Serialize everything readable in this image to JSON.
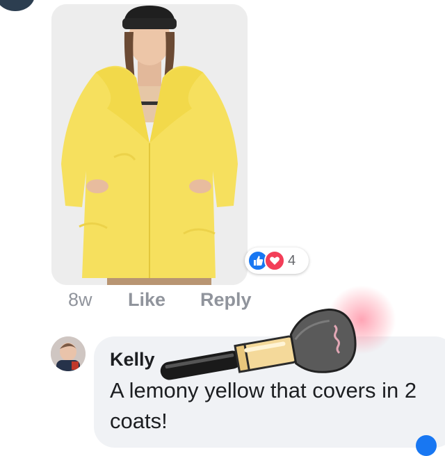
{
  "post": {
    "photo_alt": "yellow-fur-coat-photo",
    "reaction_count": "4",
    "reaction_icons": [
      "like-icon",
      "love-icon"
    ],
    "time_ago": "8w",
    "like_label": "Like",
    "reply_label": "Reply"
  },
  "comment": {
    "author": "Kelly",
    "text": "A lemony yellow that covers in 2 coats!"
  },
  "colors": {
    "coat": "#f6e05e",
    "like_blue": "#1877f2",
    "love_red": "#f33e58",
    "bubble": "#f0f2f5",
    "meta_text": "#90949c"
  },
  "overlay": {
    "icon": "makeup-brush-icon"
  }
}
